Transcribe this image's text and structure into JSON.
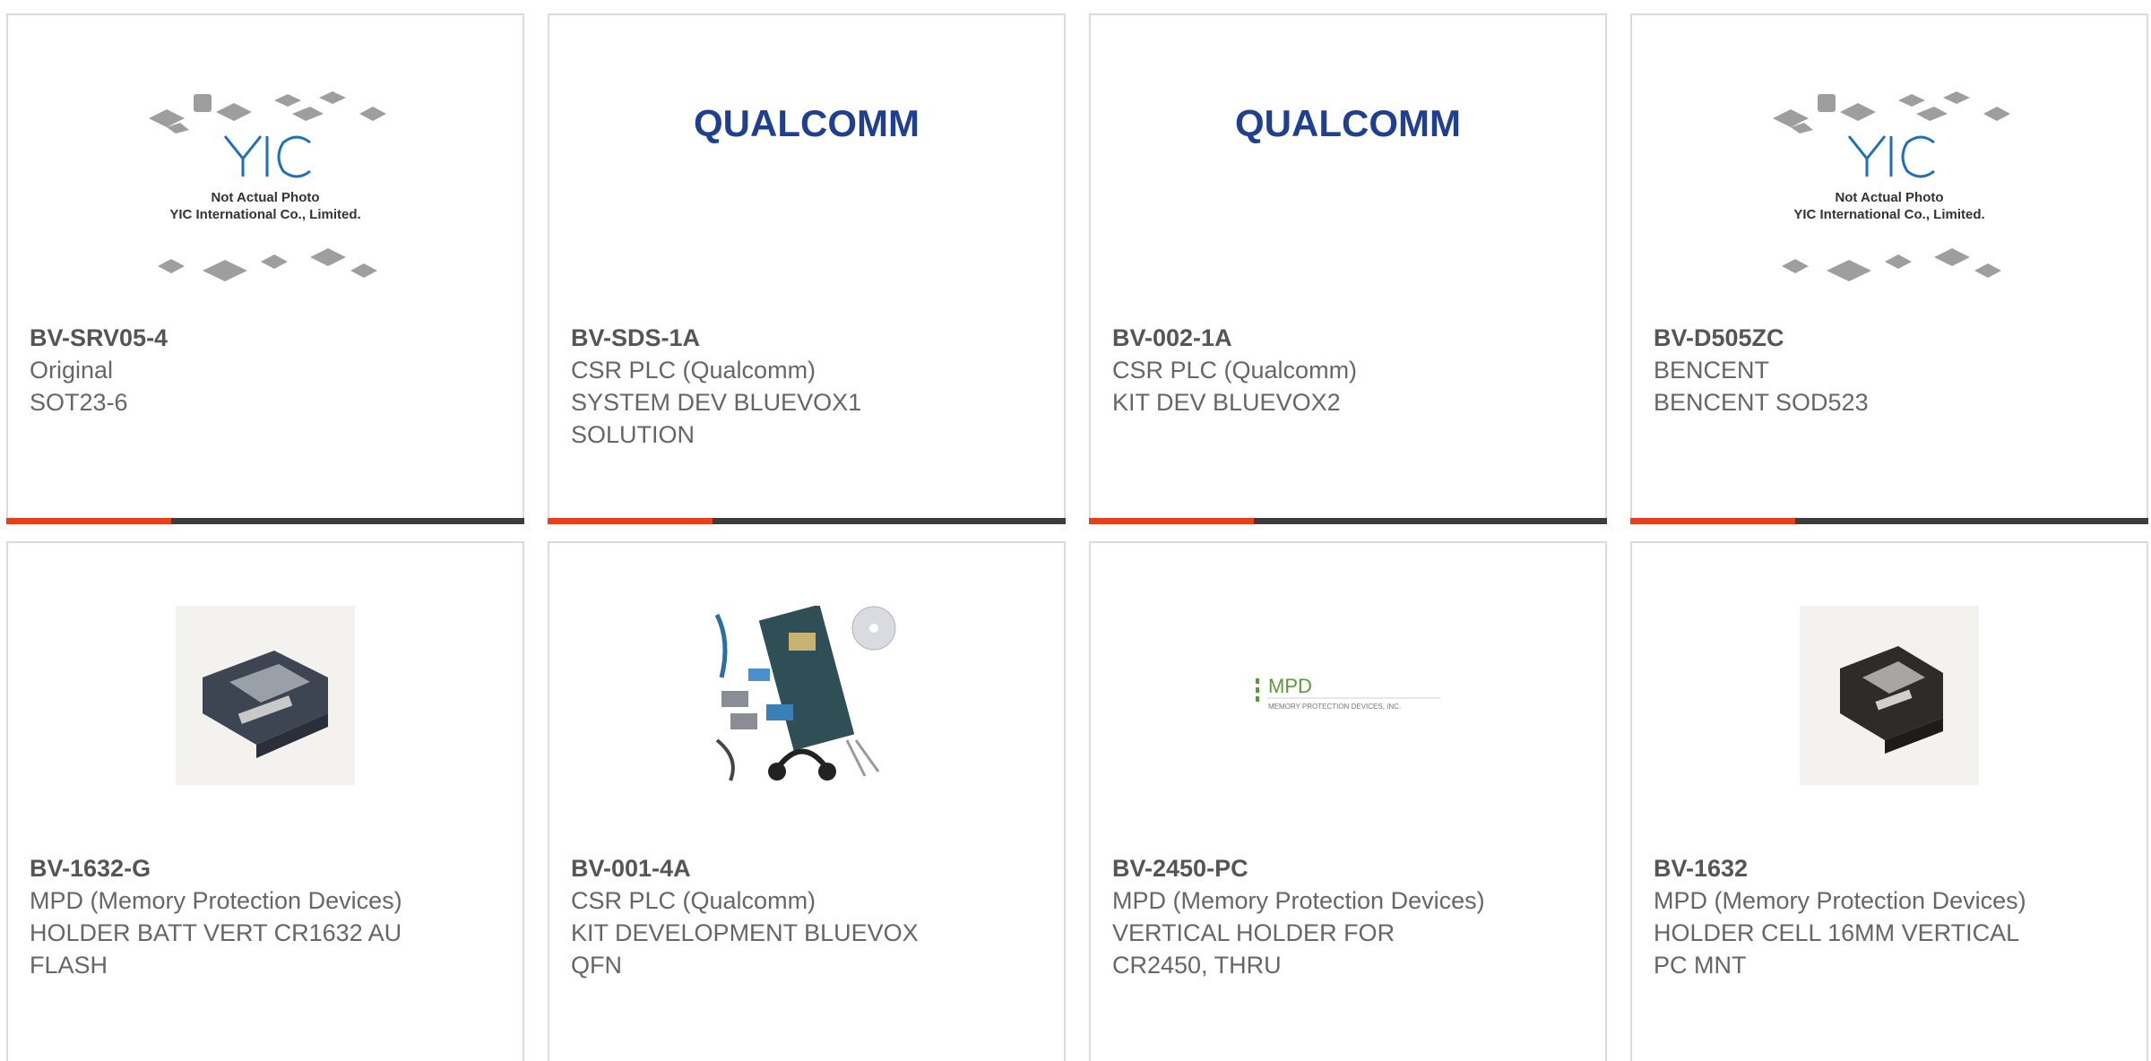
{
  "colors": {
    "accent": "#e8401c",
    "bar": "#3c3c3c",
    "border": "#dadada",
    "text": "#666666"
  },
  "products": [
    {
      "part": "BV-SRV05-4",
      "lines": [
        "Original",
        "SOT23-6"
      ],
      "image": "yic-placeholder",
      "image_text": [
        "Not Actual Photo",
        "YIC International Co., Limited."
      ]
    },
    {
      "part": "BV-SDS-1A",
      "lines": [
        "CSR PLC (Qualcomm)",
        "SYSTEM DEV BLUEVOX1 SOLUTION"
      ],
      "image": "qualcomm-logo",
      "image_text": [
        "QUALCOMM"
      ]
    },
    {
      "part": "BV-002-1A",
      "lines": [
        "CSR PLC (Qualcomm)",
        "KIT DEV BLUEVOX2"
      ],
      "image": "qualcomm-logo",
      "image_text": [
        "QUALCOMM"
      ]
    },
    {
      "part": "BV-D505ZC",
      "lines": [
        "BENCENT",
        "BENCENT SOD523"
      ],
      "image": "yic-placeholder",
      "image_text": [
        "Not Actual Photo",
        "YIC International Co., Limited."
      ]
    },
    {
      "part": "BV-1632-G",
      "lines": [
        "MPD (Memory Protection Devices)",
        "HOLDER BATT VERT CR1632 AU FLASH"
      ],
      "image": "battery-holder-photo"
    },
    {
      "part": "BV-001-4A",
      "lines": [
        "CSR PLC (Qualcomm)",
        "KIT DEVELOPMENT BLUEVOX QFN"
      ],
      "image": "dev-kit-photo"
    },
    {
      "part": "BV-2450-PC",
      "lines": [
        "MPD (Memory Protection Devices)",
        "VERTICAL HOLDER FOR CR2450, THRU"
      ],
      "image": "mpd-logo",
      "image_text": [
        "MPD",
        "MEMORY PROTECTION DEVICES, INC."
      ]
    },
    {
      "part": "BV-1632",
      "lines": [
        "MPD (Memory Protection Devices)",
        "HOLDER CELL 16MM VERTICAL PC MNT"
      ],
      "image": "battery-holder-photo"
    }
  ]
}
